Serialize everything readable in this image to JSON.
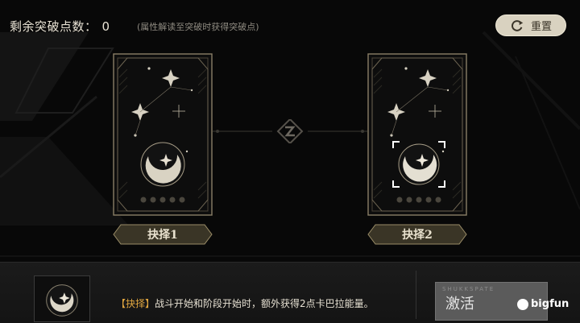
{
  "header": {
    "points_label": "剩余突破点数：",
    "points_value": "0",
    "points_hint": "(属性解读至突破时获得突破点)",
    "reset_label": "重置"
  },
  "cards": [
    {
      "choose_label": "抉择1",
      "selected": false
    },
    {
      "choose_label": "抉择2",
      "selected": true
    }
  ],
  "detail": {
    "tag": "【抉择】",
    "text": "战斗开始和阶段开始时，额外获得2点卡巴拉能量。",
    "activate_label": "激活",
    "activate_deco": "SHUKKSPATE"
  },
  "watermark": "bigfun",
  "colors": {
    "gold": "#b9a47a",
    "accent": "#e0a640",
    "panel": "#1a1a1a"
  }
}
